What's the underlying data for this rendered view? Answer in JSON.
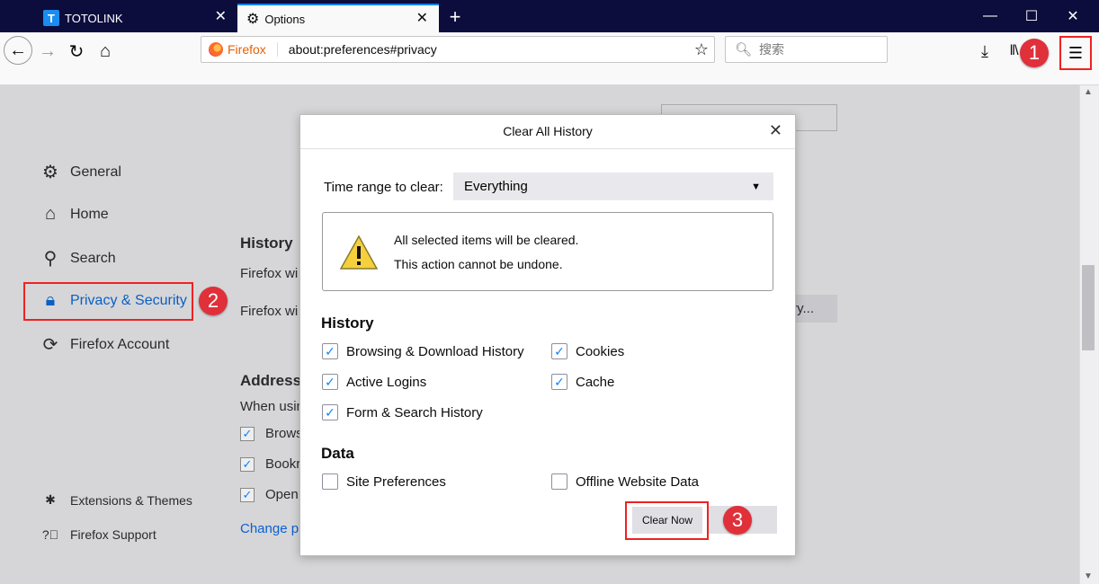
{
  "tabs": [
    {
      "label": "TOTOLINK",
      "favicon": "T"
    },
    {
      "label": "Options"
    }
  ],
  "toolbar": {
    "identity_label": "Firefox",
    "url": "about:preferences#privacy",
    "search_placeholder": "搜索",
    "menu_icon": "☰"
  },
  "sidebar": {
    "items": [
      {
        "label": "General",
        "icon": "gear-icon"
      },
      {
        "label": "Home",
        "icon": "home-icon"
      },
      {
        "label": "Search",
        "icon": "search-icon"
      },
      {
        "label": "Privacy & Security",
        "icon": "lock-icon"
      },
      {
        "label": "Firefox Account",
        "icon": "sync-icon"
      }
    ],
    "footer": [
      {
        "label": "Extensions & Themes",
        "icon": "puzzle-icon"
      },
      {
        "label": "Firefox Support",
        "icon": "help-icon"
      }
    ]
  },
  "background": {
    "history_heading": "History",
    "history_line1": "Firefox wi",
    "history_line2": "Firefox wi",
    "clear_btn_fragment": "ry...",
    "address_heading": "Address",
    "address_line": "When usin",
    "options": [
      "Brows",
      "Bookr",
      "Open"
    ],
    "change_link": "Change pr"
  },
  "dialog": {
    "title": "Clear All History",
    "time_range_label": "Time range to clear:",
    "time_range_value": "Everything",
    "warning_line1": "All selected items will be cleared.",
    "warning_line2": "This action cannot be undone.",
    "history_heading": "History",
    "history_items": [
      {
        "label": "Browsing & Download History",
        "checked": true
      },
      {
        "label": "Cookies",
        "checked": true
      },
      {
        "label": "Active Logins",
        "checked": true
      },
      {
        "label": "Cache",
        "checked": true
      },
      {
        "label": "Form & Search History",
        "checked": true
      }
    ],
    "data_heading": "Data",
    "data_items": [
      {
        "label": "Site Preferences",
        "checked": false
      },
      {
        "label": "Offline Website Data",
        "checked": false
      }
    ],
    "clear_now_label": "Clear Now"
  },
  "annotations": [
    "1",
    "2",
    "3"
  ],
  "colors": {
    "accent": "#0a84ff",
    "highlight": "#e22222",
    "titlebar": "#0c0c3d"
  }
}
